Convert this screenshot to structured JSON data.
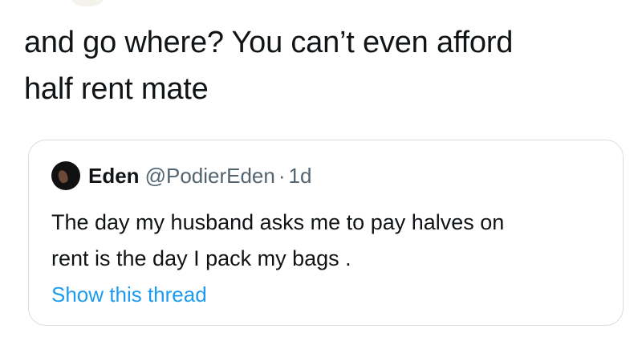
{
  "tweet": {
    "text_line1": "and go where? You can’t even afford",
    "text_line2": "half rent mate"
  },
  "quoted_tweet": {
    "author": {
      "display_name": "Eden",
      "username": "@PodierEden",
      "separator": "·",
      "timestamp": "1d"
    },
    "body_line1": "The day my husband asks me to pay halves on",
    "body_line2": "rent is the day I pack my bags .",
    "show_thread_label": "Show this thread"
  },
  "colors": {
    "text_primary": "#111416",
    "text_secondary": "#536471",
    "link": "#1d9bf0",
    "card_border": "#d8dde1"
  }
}
